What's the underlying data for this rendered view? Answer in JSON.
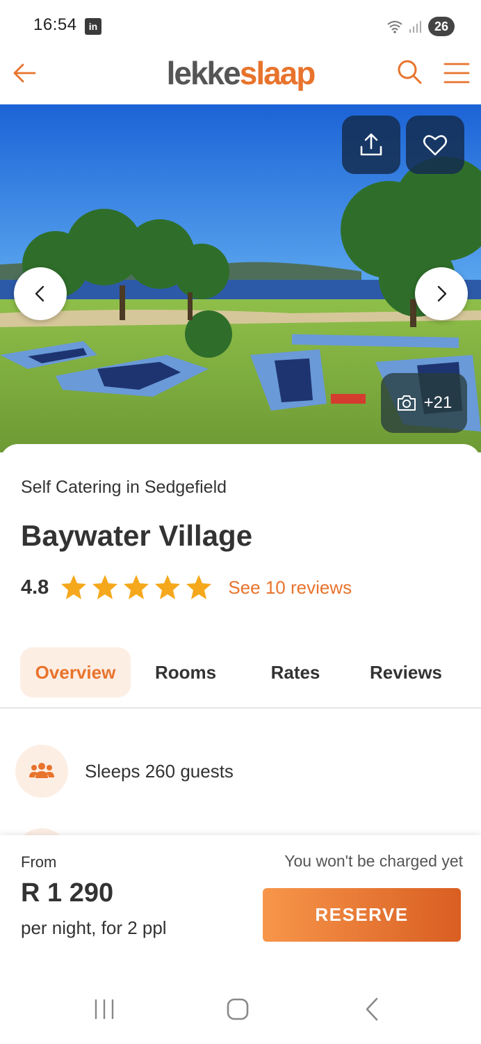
{
  "status_bar": {
    "time": "16:54",
    "linkedin_icon_label": "in",
    "battery": "26"
  },
  "header": {
    "logo_part1": "lekke",
    "logo_part2": "slaap",
    "icons": [
      "back-arrow-icon",
      "search-icon",
      "menu-icon"
    ]
  },
  "gallery": {
    "photo_count": "+21",
    "icons": [
      "share-icon",
      "heart-icon",
      "chevron-left-icon",
      "chevron-right-icon",
      "camera-icon"
    ]
  },
  "listing": {
    "subtitle": "Self Catering in Sedgefield",
    "title": "Baywater Village",
    "rating": "4.8",
    "star_count": 5,
    "reviews_link": "See 10 reviews"
  },
  "tabs": [
    {
      "label": "Overview",
      "active": true
    },
    {
      "label": "Rooms",
      "active": false
    },
    {
      "label": "Rates",
      "active": false
    },
    {
      "label": "Reviews",
      "active": false
    }
  ],
  "features": [
    {
      "icon": "people-icon",
      "text": "Sleeps 260 guests"
    }
  ],
  "booking": {
    "from_label": "From",
    "price": "R 1 290",
    "per_night": "per night, for 2 ppl",
    "charge_note": "You won't be charged yet",
    "reserve_label": "RESERVE"
  },
  "colors": {
    "accent": "#e8732c",
    "accent_light": "#fdeee4",
    "star": "#f5a81c",
    "text": "#333333"
  }
}
